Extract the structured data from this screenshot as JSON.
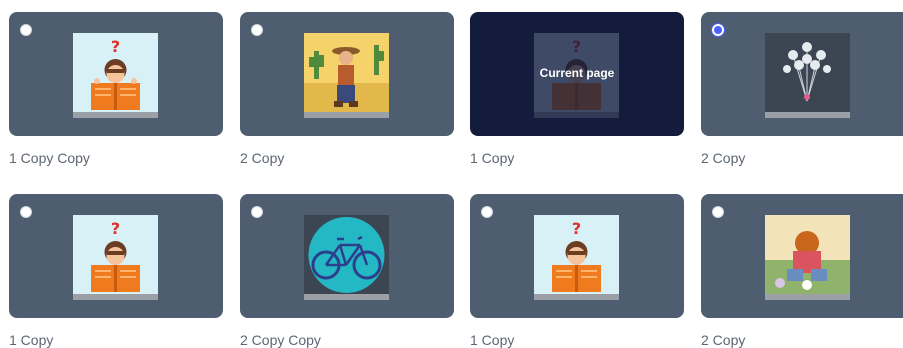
{
  "pages": [
    {
      "caption": "1 Copy Copy",
      "thumbnail": "reading-boy",
      "selected": false,
      "current": false
    },
    {
      "caption": "2 Copy",
      "thumbnail": "desert-cowboy",
      "selected": false,
      "current": false
    },
    {
      "caption": "1 Copy",
      "thumbnail": "reading-boy",
      "selected": false,
      "current": true,
      "overlay_label": "Current page"
    },
    {
      "caption": "2 Copy",
      "thumbnail": "flower-bouquet",
      "selected": true,
      "current": false
    },
    {
      "caption": "1 Copy",
      "thumbnail": "reading-boy",
      "selected": false,
      "current": false
    },
    {
      "caption": "2 Copy Copy",
      "thumbnail": "bicycle",
      "selected": false,
      "current": false
    },
    {
      "caption": "1 Copy",
      "thumbnail": "reading-boy",
      "selected": false,
      "current": false
    },
    {
      "caption": "2 Copy",
      "thumbnail": "sitting-child",
      "selected": false,
      "current": false
    }
  ],
  "colors": {
    "card_bg": "#4e5d70",
    "current_card_bg": "#141c3d",
    "radio_selected": "#4a63ff",
    "caption_text": "#5d6672"
  }
}
